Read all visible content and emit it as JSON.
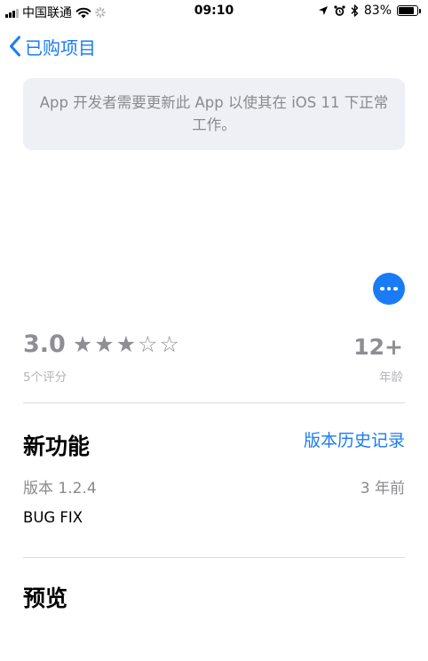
{
  "status_bar": {
    "carrier": "中国联通",
    "time": "09:10",
    "battery_percent": "83%",
    "battery_level": 0.83
  },
  "nav": {
    "back_label": "已购项目"
  },
  "notice": {
    "text": "App 开发者需要更新此 App 以使其在 iOS 11 下正常工作。"
  },
  "rating": {
    "score": "3.0",
    "stars_filled": 3,
    "stars_total": 5,
    "count_label": "5个评分"
  },
  "age": {
    "value": "12+",
    "label": "年龄"
  },
  "whats_new": {
    "title": "新功能",
    "history_link": "版本历史记录",
    "version": "版本 1.2.4",
    "date": "3 年前",
    "notes": "BUG FIX"
  },
  "preview": {
    "title": "预览"
  },
  "colors": {
    "accent": "#1a7cf5",
    "notice_bg": "#eef0f5",
    "secondary_text": "#8e8e93"
  }
}
